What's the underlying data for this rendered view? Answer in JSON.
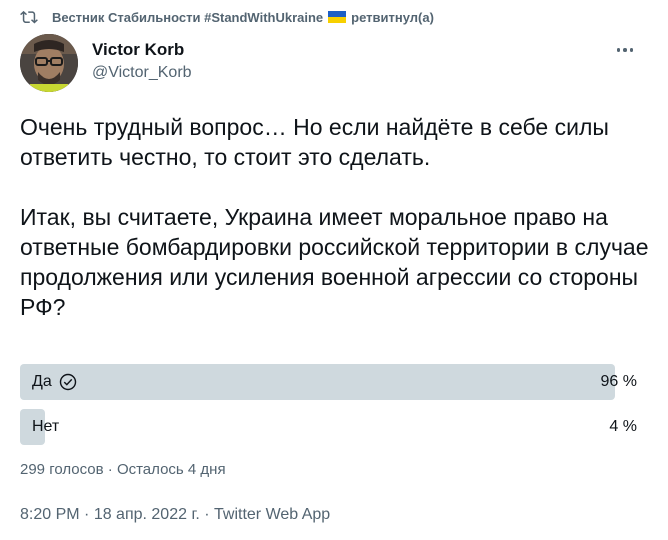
{
  "retweet": {
    "channel": "Вестник Стабильности #StandWithUkraine",
    "action": "ретвитнул(а)"
  },
  "author": {
    "name": "Victor Korb",
    "handle": "@Victor_Korb"
  },
  "tweet": {
    "text": "Очень трудный вопрос… Но если найдёте в себе силы ответить честно, то стоит это сделать.\n\nИтак, вы считаете, Украина имеет моральное право на ответные бомбардировки российской территории в случае продолжения или усиления военной агрессии со стороны РФ?"
  },
  "poll": {
    "options": [
      {
        "label": "Да",
        "percent": "96 %",
        "share": 0.96,
        "winner": true
      },
      {
        "label": "Нет",
        "percent": "4 %",
        "share": 0.04,
        "winner": false
      }
    ],
    "votes": "299 голосов",
    "remaining": "Осталось 4 дня",
    "separator": " · "
  },
  "meta": {
    "time": "8:20 PM",
    "date": "18 апр. 2022 г.",
    "source": "Twitter Web App",
    "separator": " · "
  },
  "colors": {
    "poll_fill": "#cfd9de",
    "secondary_text": "#536471",
    "primary_text": "#0f1419"
  }
}
